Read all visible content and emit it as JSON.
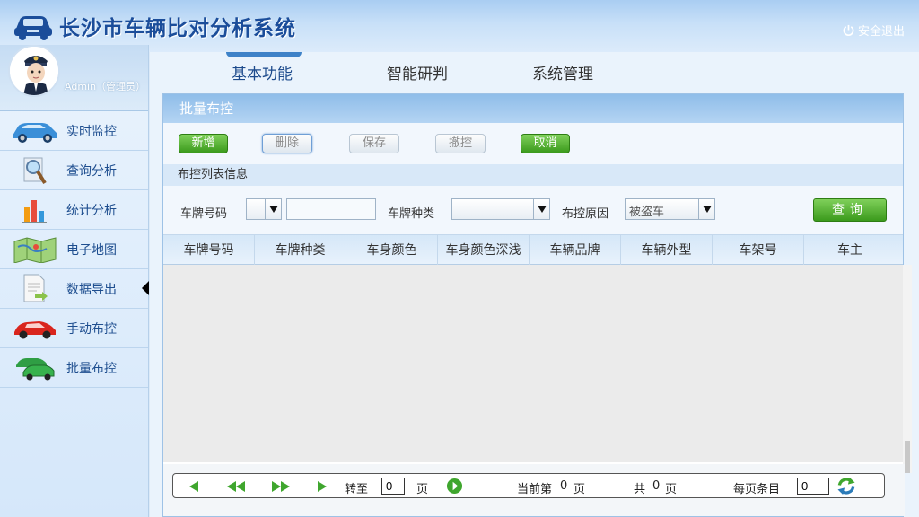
{
  "app": {
    "title": "长沙市车辆比对分析系统",
    "logout_label": "安全退出"
  },
  "user": {
    "name": "Admin（管理员）"
  },
  "sidebar": {
    "items": [
      {
        "label": "实时监控",
        "icon": "car-icon"
      },
      {
        "label": "查询分析",
        "icon": "magnifier-icon"
      },
      {
        "label": "统计分析",
        "icon": "bar-chart-icon"
      },
      {
        "label": "电子地图",
        "icon": "map-icon"
      },
      {
        "label": "数据导出",
        "icon": "export-document-icon"
      },
      {
        "label": "手动布控",
        "icon": "red-car-icon"
      },
      {
        "label": "批量布控",
        "icon": "green-cars-icon"
      }
    ],
    "active_index": 4
  },
  "tabs": [
    {
      "label": "基本功能",
      "active": true
    },
    {
      "label": "智能研判",
      "active": false
    },
    {
      "label": "系统管理",
      "active": false
    }
  ],
  "panel": {
    "title": "批量布控",
    "buttons": {
      "add": "新增",
      "delete": "删除",
      "save": "保存",
      "revoke": "撤控",
      "cancel": "取消"
    },
    "section_title": "布控列表信息",
    "filters": {
      "plate_label": "车牌号码",
      "plate_prefix": "",
      "plate_value": "",
      "plate_type_label": "车牌种类",
      "plate_type_value": "",
      "reason_label": "布控原因",
      "reason_value": "被盗车",
      "query_label": "查询"
    },
    "columns": [
      "车牌号码",
      "车牌种类",
      "车身颜色",
      "车身颜色深浅",
      "车辆品牌",
      "车辆外型",
      "车架号",
      "车主"
    ],
    "rows": []
  },
  "pager": {
    "goto_label": "转至",
    "goto_value": "0",
    "page_unit": "页",
    "current_prefix": "当前第",
    "current_page": "0",
    "current_suffix": "页",
    "total_prefix": "共",
    "total_pages": "0",
    "total_suffix": "页",
    "per_page_label": "每页条目",
    "per_page_value": "0"
  },
  "colors": {
    "accent": "#1b4d9a",
    "green_button": "#3b9a1c",
    "header_bg": "#a9cdf2"
  }
}
